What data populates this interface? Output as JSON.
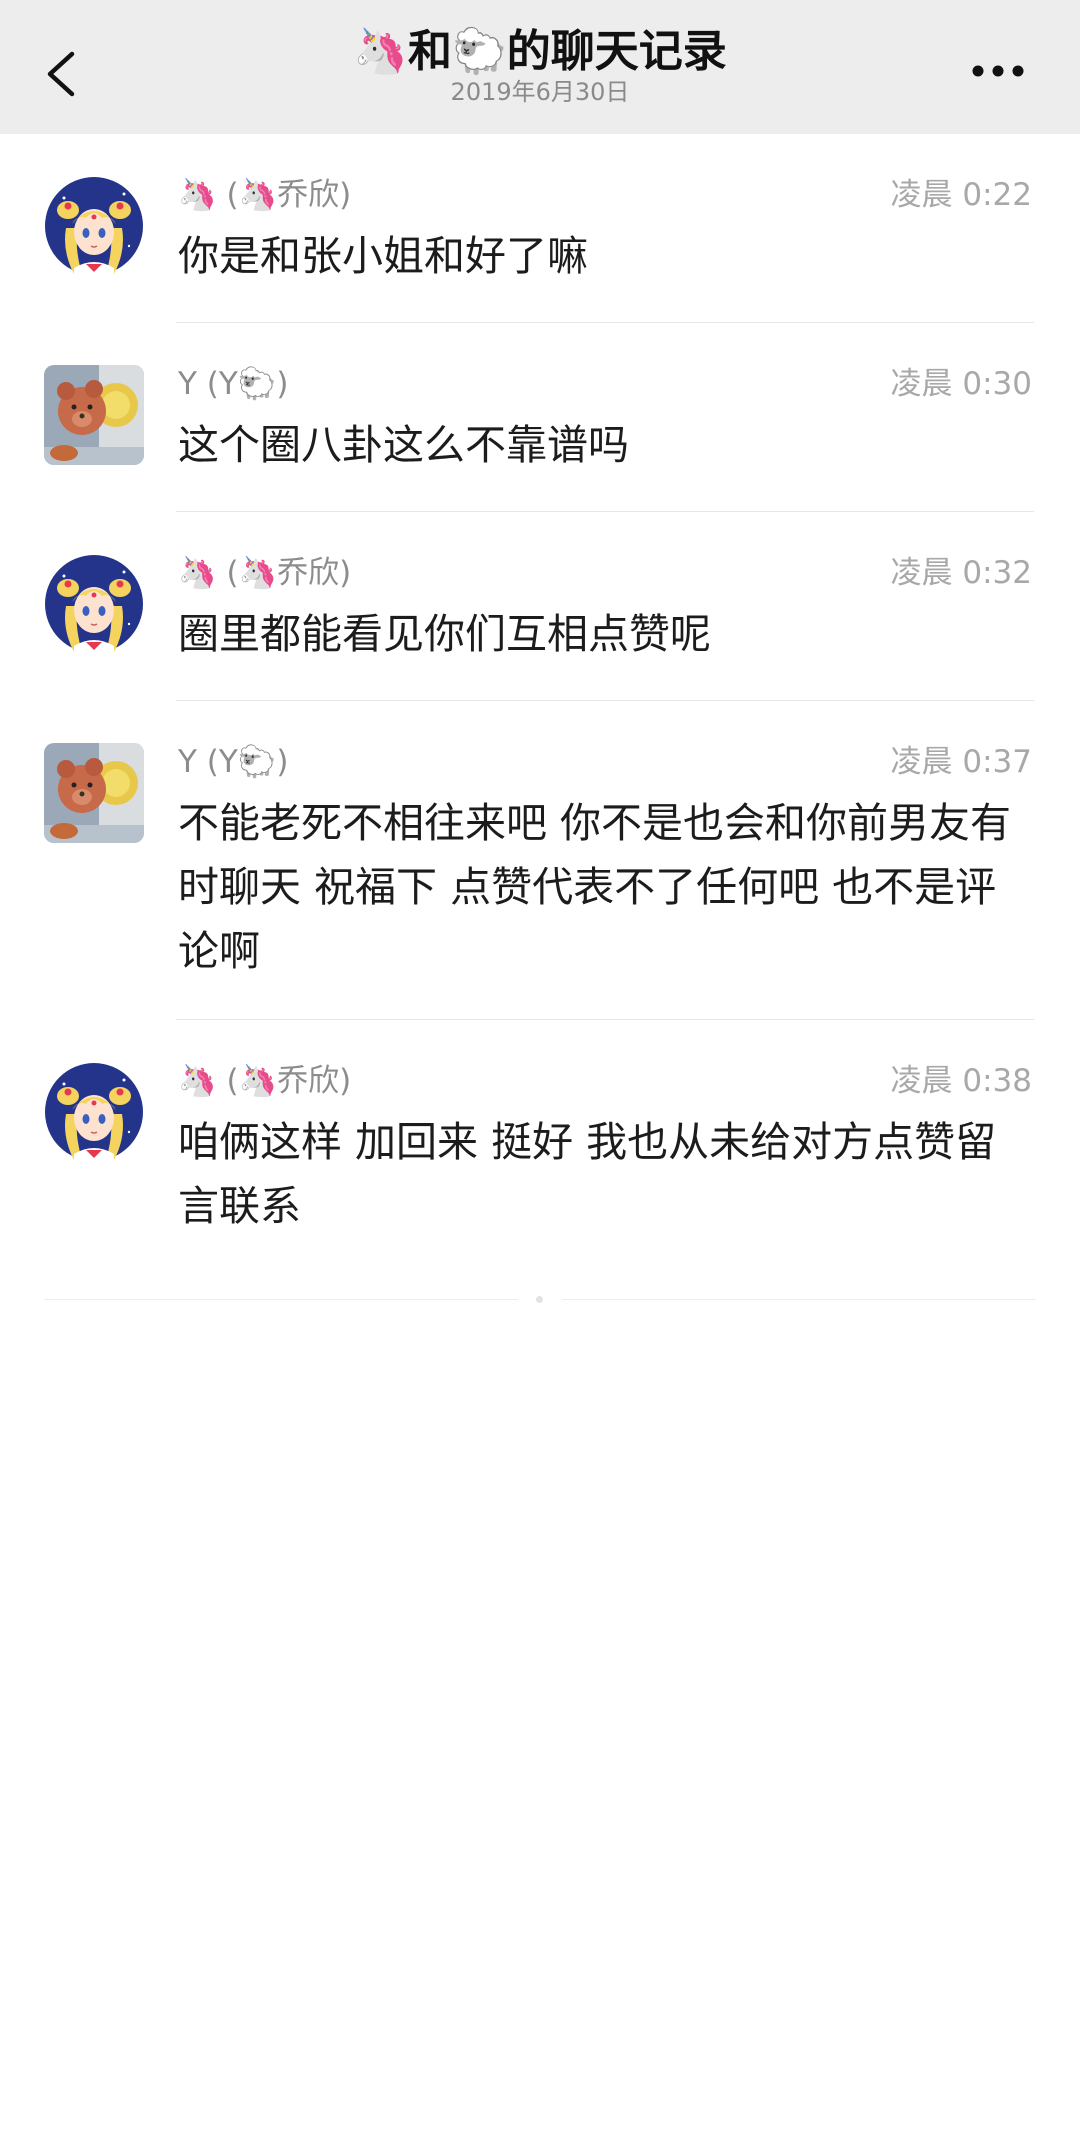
{
  "header": {
    "title": "🦄和🐑的聊天记录",
    "subtitle": "2019年6月30日"
  },
  "messages": [
    {
      "avatar": "sailor-moon-avatar",
      "sender": "🦄 (🦄乔欣)",
      "time": "凌晨 0:22",
      "text": "你是和张小姐和好了嘛"
    },
    {
      "avatar": "bear-photo-avatar",
      "sender": "Y (Y🐑)",
      "time": "凌晨 0:30",
      "text": "这个圈八卦这么不靠谱吗"
    },
    {
      "avatar": "sailor-moon-avatar",
      "sender": "🦄 (🦄乔欣)",
      "time": "凌晨 0:32",
      "text": "圈里都能看见你们互相点赞呢"
    },
    {
      "avatar": "bear-photo-avatar",
      "sender": "Y (Y🐑)",
      "time": "凌晨 0:37",
      "text": "不能老死不相往来吧 你不是也会和你前男友有时聊天 祝福下 点赞代表不了任何吧 也不是评论啊"
    },
    {
      "avatar": "sailor-moon-avatar",
      "sender": "🦄 (🦄乔欣)",
      "time": "凌晨 0:38",
      "text": "咱俩这样 加回来 挺好  我也从未给对方点赞留言联系"
    }
  ]
}
